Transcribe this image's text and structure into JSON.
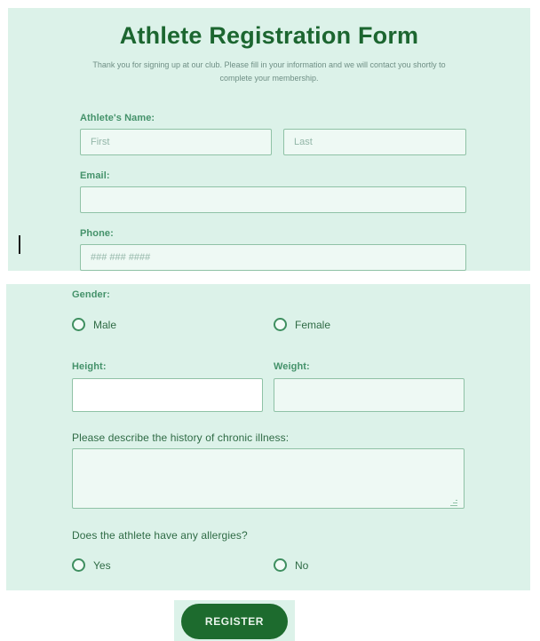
{
  "page": {
    "title": "Athlete Registration Form",
    "description": "Thank you for signing up at our club. Please fill in your information and we will contact you shortly to complete your membership.",
    "background_color": "#ffffff",
    "panel_color": "#dcf2e9",
    "title_color": "#1c6630",
    "label_color": "#44926a",
    "accent_color": "#1d6b2e"
  },
  "personal_section": {
    "name": {
      "label": "Athlete's Name:",
      "first": {
        "value": "",
        "placeholder": "First"
      },
      "last": {
        "value": "",
        "placeholder": "Last"
      }
    },
    "email": {
      "label": "Email:",
      "value": "",
      "placeholder": ""
    },
    "phone": {
      "label": "Phone:",
      "value": "",
      "placeholder": "### ### ####"
    }
  },
  "details_section": {
    "gender": {
      "label": "Gender:",
      "options": [
        {
          "label": "Male",
          "selected": false
        },
        {
          "label": "Female",
          "selected": false
        }
      ]
    },
    "height": {
      "label": "Height:",
      "value": "",
      "placeholder": "",
      "focused": true
    },
    "weight": {
      "label": "Weight:",
      "value": "",
      "placeholder": "",
      "focused": false
    },
    "illness": {
      "label": "Please describe the history of chronic illness:",
      "value": "",
      "placeholder": ""
    },
    "allergies": {
      "label": "Does the athlete have any allergies?",
      "options": [
        {
          "label": "Yes",
          "selected": false
        },
        {
          "label": "No",
          "selected": false
        }
      ]
    }
  },
  "submit": {
    "label": "REGISTER"
  }
}
